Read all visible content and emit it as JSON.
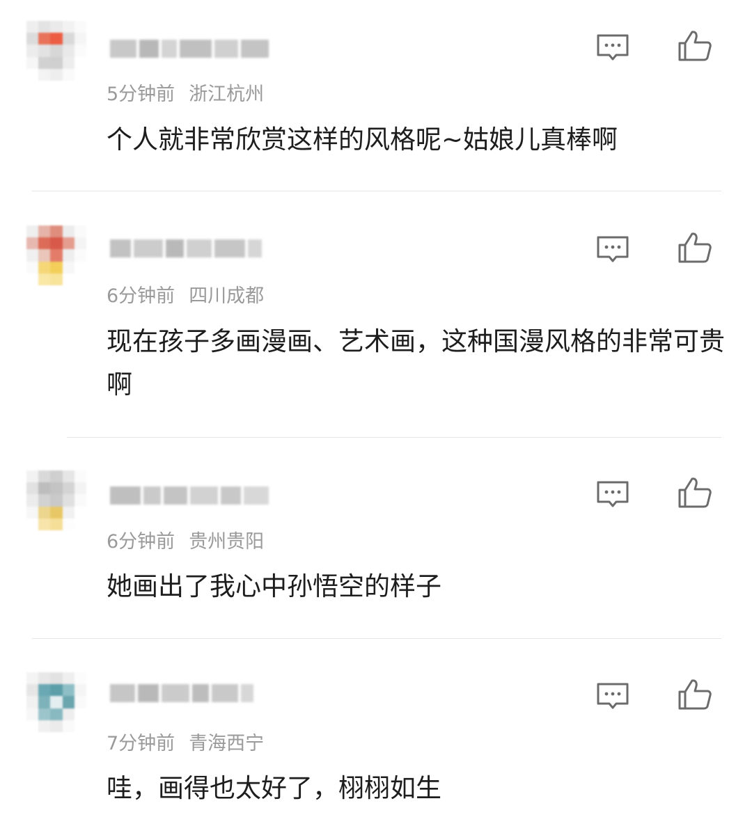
{
  "comments": [
    {
      "time": "5分钟前",
      "location": "浙江杭州",
      "text": "个人就非常欣赏这样的风格呢~姑娘儿真棒啊",
      "reply_icon": "comment-icon",
      "like_icon": "thumbs-up-icon"
    },
    {
      "time": "6分钟前",
      "location": "四川成都",
      "text": "现在孩子多画漫画、艺术画，这种国漫风格的非常可贵啊",
      "reply_icon": "comment-icon",
      "like_icon": "thumbs-up-icon"
    },
    {
      "time": "6分钟前",
      "location": "贵州贵阳",
      "text": "她画出了我心中孙悟空的样子",
      "reply_icon": "comment-icon",
      "like_icon": "thumbs-up-icon"
    },
    {
      "time": "7分钟前",
      "location": "青海西宁",
      "text": "哇，画得也太好了，栩栩如生",
      "reply_icon": "comment-icon",
      "like_icon": "thumbs-up-icon"
    }
  ],
  "colors": {
    "meta_text": "#9a9a9a",
    "body_text": "#1d1d1d",
    "icon_stroke": "#6b6b6b",
    "divider": "#e6e6e6"
  }
}
